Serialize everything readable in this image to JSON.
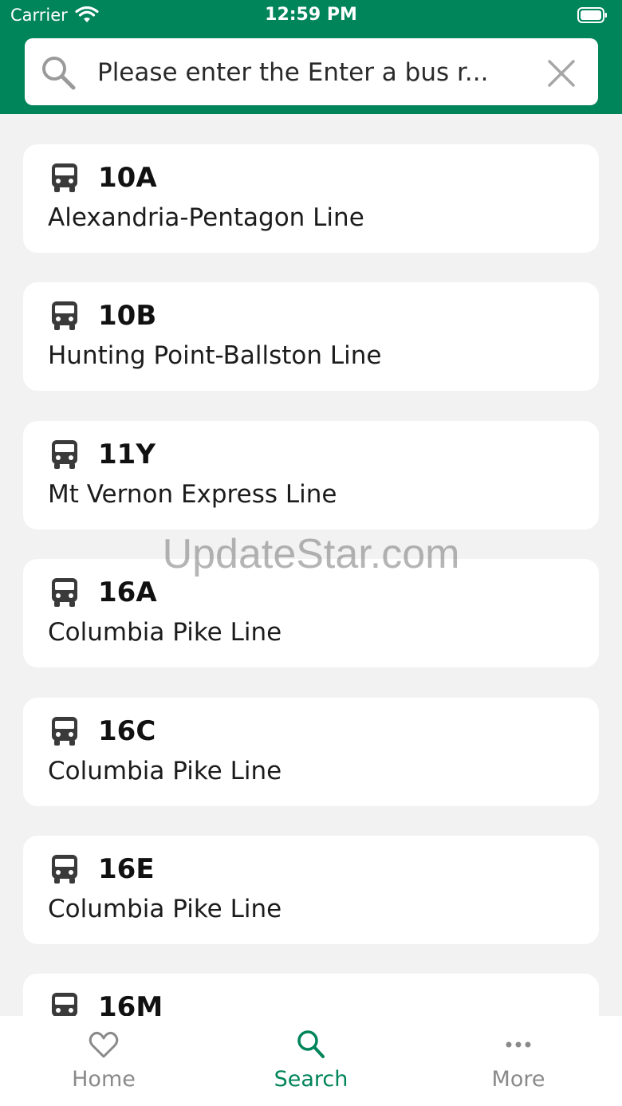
{
  "status_bar": {
    "carrier": "Carrier",
    "time": "12:59 PM"
  },
  "search": {
    "text": "Please enter the Enter a bus r..."
  },
  "routes": [
    {
      "number": "10A",
      "name": "Alexandria-Pentagon Line"
    },
    {
      "number": "10B",
      "name": "Hunting Point-Ballston Line"
    },
    {
      "number": "11Y",
      "name": "Mt Vernon Express Line"
    },
    {
      "number": "16A",
      "name": "Columbia Pike Line"
    },
    {
      "number": "16C",
      "name": "Columbia Pike Line"
    },
    {
      "number": "16E",
      "name": "Columbia Pike Line"
    },
    {
      "number": "16M",
      "name": ""
    }
  ],
  "watermark": "UpdateStar.com",
  "tabs": [
    {
      "label": "Home",
      "icon": "heart-icon",
      "active": false
    },
    {
      "label": "Search",
      "icon": "search-icon",
      "active": true
    },
    {
      "label": "More",
      "icon": "more-icon",
      "active": false
    }
  ],
  "colors": {
    "accent": "#00845a",
    "background": "#f2f2f2",
    "card": "#ffffff",
    "inactive_tab": "#8a8a8a"
  }
}
